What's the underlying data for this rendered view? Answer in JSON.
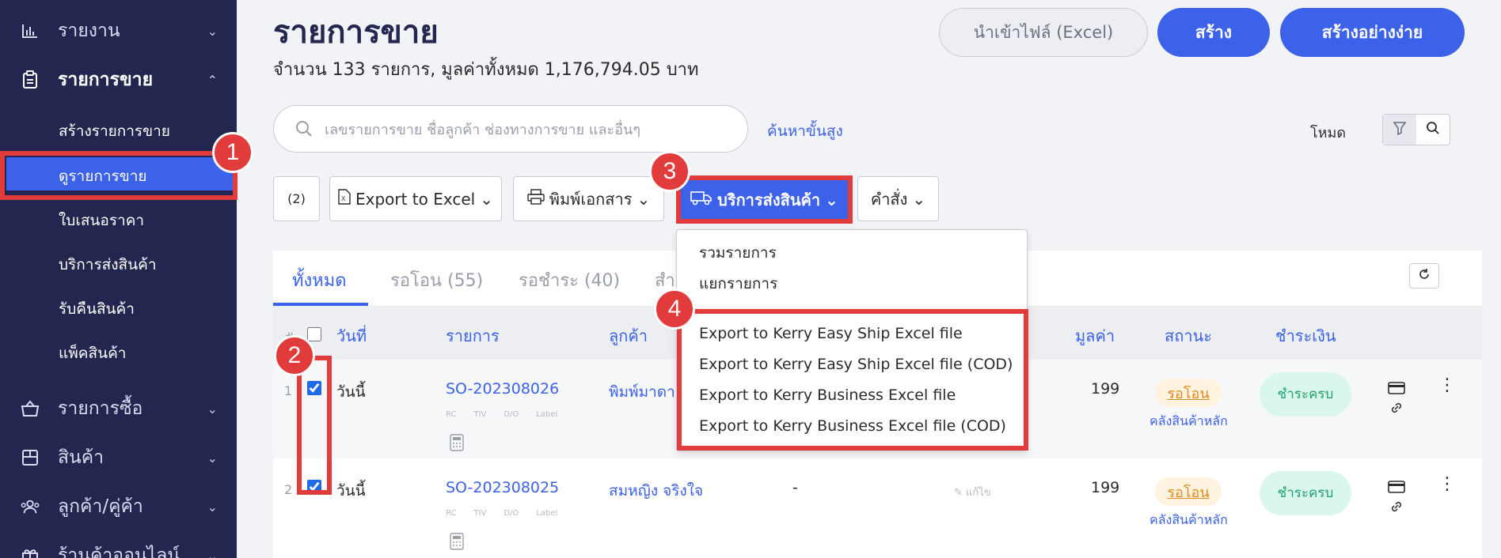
{
  "sidebar": {
    "items": [
      {
        "label": "รายงาน",
        "icon": "bar-chart-icon"
      },
      {
        "label": "รายการขาย",
        "icon": "clipboard-icon"
      },
      {
        "label": "รายการซื้อ",
        "icon": "basket-icon"
      },
      {
        "label": "สินค้า",
        "icon": "box-icon"
      },
      {
        "label": "ลูกค้า/คู่ค้า",
        "icon": "people-icon"
      },
      {
        "label": "ร้านค้าออนไลน์",
        "icon": "gift-icon"
      }
    ],
    "sub_items": [
      "สร้างรายการขาย",
      "ดูรายการขาย",
      "ใบเสนอราคา",
      "บริการส่งสินค้า",
      "รับคืนสินค้า",
      "แพ็คสินค้า"
    ]
  },
  "callouts": [
    "1",
    "2",
    "3",
    "4"
  ],
  "header": {
    "title": "รายการขาย",
    "summary": "จำนวน 133 รายการ, มูลค่าทั้งหมด 1,176,794.05 บาท",
    "import_label": "นำเข้าไฟล์ (Excel)",
    "create_label": "สร้าง",
    "create_simple_label": "สร้างอย่างง่าย"
  },
  "search": {
    "placeholder": "เลขรายการขาย ชื่อลูกค้า ช่องทางการขาย และอื่นๆ",
    "advanced_label": "ค้นหาขั้นสูง",
    "mode_label": "โหมด"
  },
  "toolbar": {
    "selected_count": "(2)",
    "export_label": "Export to Excel",
    "print_label": "พิมพ์เอกสาร",
    "shipping_label": "บริการส่งสินค้า",
    "command_label": "คำสั่ง"
  },
  "dropdown": {
    "items": [
      "รวมรายการ",
      "แยกรายการ",
      "Export to Kerry Easy Ship Excel file",
      "Export to Kerry Easy Ship Excel file (COD)",
      "Export to Kerry Business Excel file",
      "Export to Kerry Business Excel file (COD)"
    ]
  },
  "tabs": [
    "ทั้งหมด",
    "รอโอน (55)",
    "รอชำระ (40)",
    "สำ"
  ],
  "table": {
    "headers": {
      "hash": "#",
      "date": "วันที่",
      "order": "รายการ",
      "customer": "ลูกค้า",
      "amount": "มูลค่า",
      "status": "สถานะ",
      "payment": "ชำระเงิน"
    },
    "tag_labels": [
      "RC",
      "TIV",
      "D/O",
      "Label"
    ],
    "rows": [
      {
        "index": "1",
        "date": "วันนี้",
        "order": "SO-202308026",
        "customer": "พิมพ์มาดา",
        "dash": "",
        "edit": "",
        "amount": "199",
        "status": "รอโอน",
        "warehouse": "คลังสินค้าหลัก",
        "payment": "ชำระครบ"
      },
      {
        "index": "2",
        "date": "วันนี้",
        "order": "SO-202308025",
        "customer": "สมหญิง จริงใจ",
        "dash": "-",
        "edit": "แก้ไข",
        "amount": "199",
        "status": "รอโอน",
        "warehouse": "คลังสินค้าหลัก",
        "payment": "ชำระครบ"
      }
    ]
  },
  "colors": {
    "sidebar": "#23264f",
    "primary": "#3b62e8",
    "callout": "#e23b3b",
    "pending": "#e08a1e",
    "paid": "#22a06b"
  }
}
